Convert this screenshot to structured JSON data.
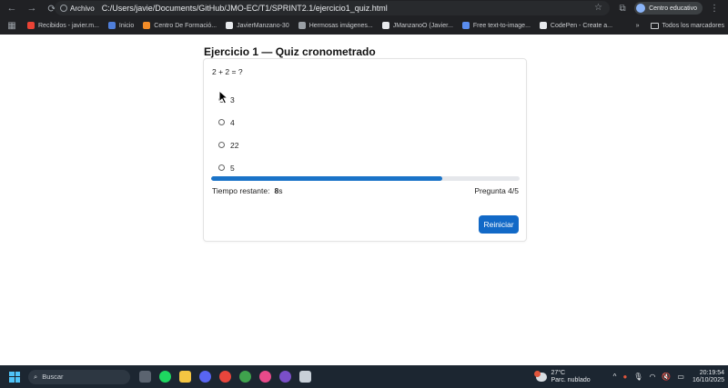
{
  "browser": {
    "nav": {
      "back": "←",
      "forward": "→",
      "reload": "⟳"
    },
    "address": {
      "chip_label": "Archivo",
      "url": "C:/Users/javie/Documents/GitHub/JMO-EC/T1/SPRINT2.1/ejercicio1_quiz.html"
    },
    "profile_label": "Centro educativo",
    "bookmarks": [
      {
        "label": "Recibidos - javier.m...",
        "color": "#ea4335"
      },
      {
        "label": "Inicio",
        "color": "#4f7fdb"
      },
      {
        "label": "Centro De Formació...",
        "color": "#f28c28"
      },
      {
        "label": "JavierManzano-30",
        "color": "#e8eaed"
      },
      {
        "label": "Hermosas imágenes...",
        "color": "#9aa0a6"
      },
      {
        "label": "JManzanoO (Javier...",
        "color": "#e8eaed"
      },
      {
        "label": "Free text-to-image...",
        "color": "#5a8dee"
      },
      {
        "label": "CodePen - Create a...",
        "color": "#e8eaed"
      }
    ],
    "bookmarks_more": "»",
    "all_bookmarks": "Todos los marcadores"
  },
  "quiz": {
    "title": "Ejercicio 1 — Quiz cronometrado",
    "question": "2 + 2 = ?",
    "options": [
      "3",
      "4",
      "22",
      "5"
    ],
    "progress_fraction": 0.75,
    "timer_label": "Tiempo restante:",
    "timer_value": "8",
    "timer_unit": "s",
    "counter": "Pregunta 4/5",
    "restart_button": "Reiniciar"
  },
  "taskbar": {
    "search_placeholder": "Buscar",
    "weather_temp": "27°C",
    "weather_desc": "Parc. nublado",
    "time": "20:19:54",
    "date": "16/10/2025"
  },
  "colors": {
    "accent": "#1269c7",
    "progress": "#1a73c8",
    "chrome": "#202124",
    "taskbar": "#1c2631"
  }
}
